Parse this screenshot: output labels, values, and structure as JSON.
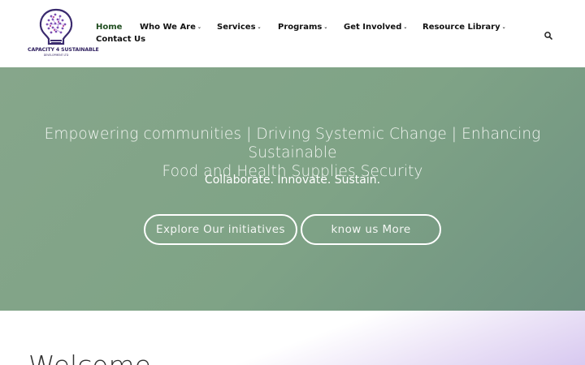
{
  "brand": {
    "logo_text": "CAPACITY 4 SUSTAINABLE",
    "logo_subtext": "DEVELOPMENT LTD"
  },
  "nav": {
    "items": [
      {
        "label": "Home",
        "active": true,
        "has_dropdown": false
      },
      {
        "label": "Who We Are",
        "has_dropdown": true
      },
      {
        "label": "Services",
        "has_dropdown": true
      },
      {
        "label": "Programs",
        "has_dropdown": true
      },
      {
        "label": "Get Involved",
        "has_dropdown": true
      },
      {
        "label": "Resource Library",
        "has_dropdown": true
      },
      {
        "label": "Contact Us",
        "has_dropdown": false
      }
    ],
    "caret": "⌄",
    "search_icon": "search-icon"
  },
  "hero": {
    "title_line1": "Empowering communities | Driving Systemic Change | Enhancing Sustainable",
    "title_line2": "Food and Health Supplies Security",
    "subtitle": "Collaborate. Innovate. Sustain.",
    "button_primary": "Explore Our initiatives",
    "button_secondary": "know us More",
    "bg_color": "#82a589"
  },
  "welcome": {
    "title": "Welcome"
  },
  "colors": {
    "brand_purple": "#2e1f5e",
    "active_nav": "#1f4d1f"
  }
}
